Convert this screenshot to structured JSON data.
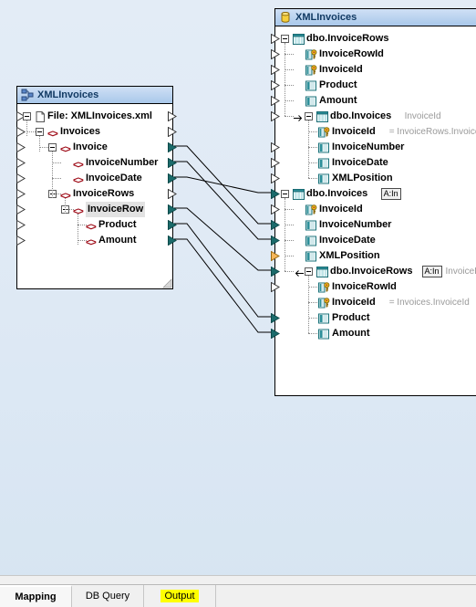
{
  "window": {
    "background_accent": "#dce8f5"
  },
  "source_component": {
    "title": "XMLInvoices",
    "title_icon": "xml-schema-icon",
    "nodes": [
      {
        "label": "File: XMLInvoices.xml",
        "icon": "file-icon",
        "depth": 0,
        "expander": true,
        "out": "hollow"
      },
      {
        "label": "Invoices",
        "icon": "element-icon",
        "depth": 1,
        "expander": true,
        "out": "hollow"
      },
      {
        "label": "Invoice",
        "icon": "element-icon",
        "depth": 2,
        "expander": true,
        "out": "filled"
      },
      {
        "label": "InvoiceNumber",
        "icon": "element-icon",
        "depth": 3,
        "expander": false,
        "out": "filled"
      },
      {
        "label": "InvoiceDate",
        "icon": "element-icon",
        "depth": 3,
        "expander": false,
        "out": "filled"
      },
      {
        "label": "InvoiceRows",
        "icon": "element-icon",
        "depth": 2,
        "expander": true,
        "out": "hollow"
      },
      {
        "label": "InvoiceRow",
        "icon": "element-icon",
        "depth": 3,
        "expander": true,
        "out": "filled",
        "selected": true
      },
      {
        "label": "Product",
        "icon": "element-icon",
        "depth": 4,
        "expander": false,
        "out": "filled"
      },
      {
        "label": "Amount",
        "icon": "element-icon",
        "depth": 4,
        "expander": false,
        "out": "filled"
      }
    ]
  },
  "target_component": {
    "title": "XMLInvoices",
    "title_icon": "database-icon",
    "nodes": [
      {
        "label": "dbo.InvoiceRows",
        "icon": "table-icon",
        "depth": 0,
        "expander": true,
        "in": "hollow"
      },
      {
        "label": "InvoiceRowId",
        "icon": "key-column-icon",
        "depth": 1,
        "expander": false,
        "in": "hollow"
      },
      {
        "label": "InvoiceId",
        "icon": "key-column-icon",
        "depth": 1,
        "expander": false,
        "in": "hollow"
      },
      {
        "label": "Product",
        "icon": "column-icon",
        "depth": 1,
        "expander": false,
        "in": "hollow"
      },
      {
        "label": "Amount",
        "icon": "column-icon",
        "depth": 1,
        "expander": false,
        "in": "hollow"
      },
      {
        "label": "dbo.Invoices",
        "icon": "table-icon",
        "depth": 1,
        "expander": true,
        "in": "hollow",
        "arrow": "right",
        "suffix": "InvoiceId"
      },
      {
        "label": "InvoiceId",
        "icon": "key-column-icon",
        "depth": 2,
        "expander": false,
        "in": "none",
        "eq": "= InvoiceRows.InvoiceId"
      },
      {
        "label": "InvoiceNumber",
        "icon": "column-icon",
        "depth": 2,
        "expander": false,
        "in": "hollow"
      },
      {
        "label": "InvoiceDate",
        "icon": "column-icon",
        "depth": 2,
        "expander": false,
        "in": "hollow"
      },
      {
        "label": "XMLPosition",
        "icon": "column-icon",
        "depth": 2,
        "expander": false,
        "in": "hollow"
      },
      {
        "label": "dbo.Invoices",
        "icon": "table-icon",
        "depth": 0,
        "expander": true,
        "in": "filled",
        "badge": "A:In"
      },
      {
        "label": "InvoiceId",
        "icon": "key-column-icon",
        "depth": 1,
        "expander": false,
        "in": "hollow"
      },
      {
        "label": "InvoiceNumber",
        "icon": "column-icon",
        "depth": 1,
        "expander": false,
        "in": "filled"
      },
      {
        "label": "InvoiceDate",
        "icon": "column-icon",
        "depth": 1,
        "expander": false,
        "in": "filled"
      },
      {
        "label": "XMLPosition",
        "icon": "column-icon",
        "depth": 1,
        "expander": false,
        "in": "orange"
      },
      {
        "label": "dbo.InvoiceRows",
        "icon": "table-icon",
        "depth": 1,
        "expander": true,
        "in": "filled",
        "arrow": "left",
        "badge": "A:In",
        "suffix": "InvoiceId"
      },
      {
        "label": "InvoiceRowId",
        "icon": "key-column-icon",
        "depth": 2,
        "expander": false,
        "in": "hollow"
      },
      {
        "label": "InvoiceId",
        "icon": "key-column-icon",
        "depth": 2,
        "expander": false,
        "in": "none",
        "eq": "= Invoices.InvoiceId"
      },
      {
        "label": "Product",
        "icon": "column-icon",
        "depth": 2,
        "expander": false,
        "in": "filled"
      },
      {
        "label": "Amount",
        "icon": "column-icon",
        "depth": 2,
        "expander": false,
        "in": "filled"
      }
    ]
  },
  "connections": [
    {
      "from_row": 2,
      "to_row": 12
    },
    {
      "from_row": 3,
      "to_row": 13
    },
    {
      "from_row": 4,
      "to_row": 10
    },
    {
      "from_row": 6,
      "to_row": 15
    },
    {
      "from_row": 7,
      "to_row": 18
    },
    {
      "from_row": 8,
      "to_row": 19
    }
  ],
  "tabs": [
    {
      "label": "Mapping",
      "active": true,
      "highlighted": false
    },
    {
      "label": "DB Query",
      "active": false,
      "highlighted": false
    },
    {
      "label": "Output",
      "active": false,
      "highlighted": true
    }
  ]
}
